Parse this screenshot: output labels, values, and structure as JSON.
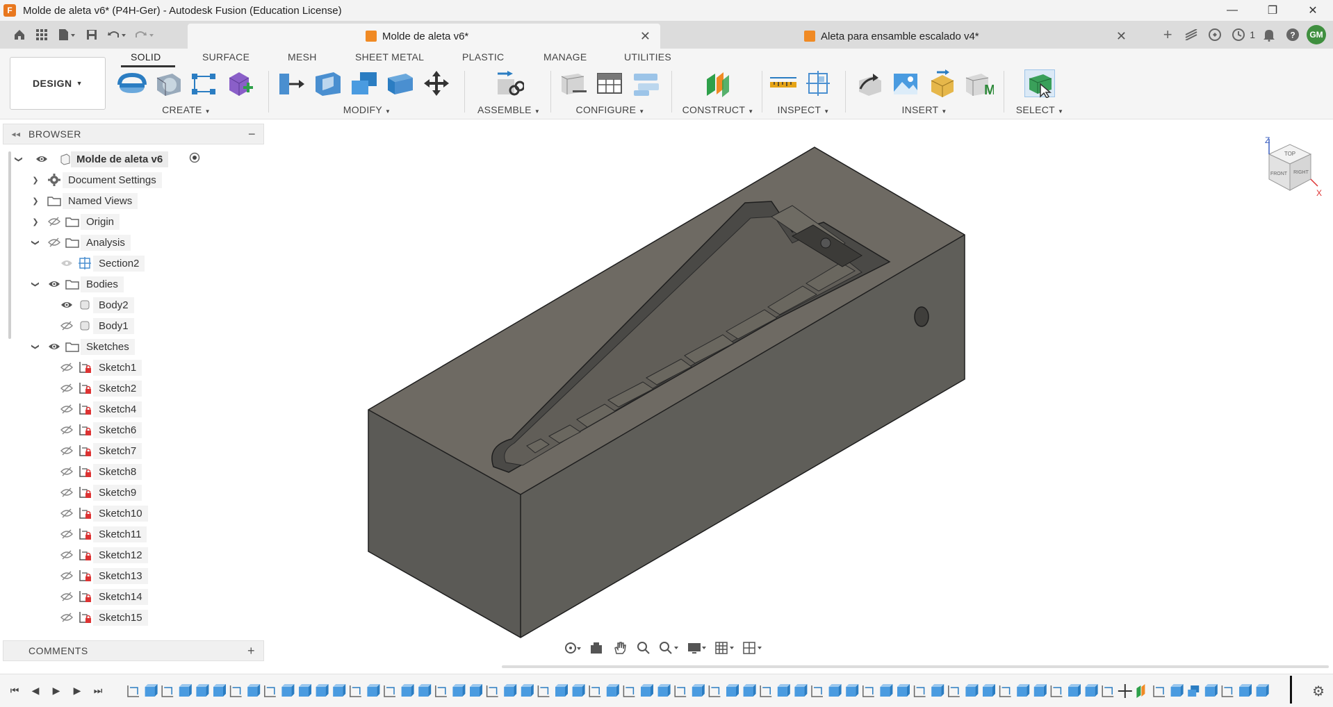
{
  "window": {
    "title": "Molde de aleta v6* (P4H-Ger) - Autodesk Fusion (Education License)",
    "minimize": "—",
    "maximize": "❐",
    "close": "✕"
  },
  "tabs": {
    "active": {
      "label": "Molde de aleta v6*",
      "close": "✕"
    },
    "inactive": {
      "label": "Aleta para ensamble escalado v4*",
      "close": "✕"
    },
    "plus": "+",
    "job_count": "1",
    "user_initials": "GM"
  },
  "toolbar": {
    "workspace": "DESIGN",
    "workspace_tabs": [
      "SOLID",
      "SURFACE",
      "MESH",
      "SHEET METAL",
      "PLASTIC",
      "MANAGE",
      "UTILITIES"
    ],
    "groups": {
      "create": "CREATE",
      "modify": "MODIFY",
      "assemble": "ASSEMBLE",
      "configure": "CONFIGURE",
      "construct": "CONSTRUCT",
      "inspect": "INSPECT",
      "insert": "INSERT",
      "select": "SELECT"
    }
  },
  "browser": {
    "title": "BROWSER",
    "items": [
      {
        "label": "Molde de aleta v6"
      },
      {
        "label": "Document Settings"
      },
      {
        "label": "Named Views"
      },
      {
        "label": "Origin"
      },
      {
        "label": "Analysis"
      },
      {
        "label": "Section2"
      },
      {
        "label": "Bodies"
      },
      {
        "label": "Body2"
      },
      {
        "label": "Body1"
      },
      {
        "label": "Sketches"
      },
      {
        "label": "Sketch1"
      },
      {
        "label": "Sketch2"
      },
      {
        "label": "Sketch4"
      },
      {
        "label": "Sketch6"
      },
      {
        "label": "Sketch7"
      },
      {
        "label": "Sketch8"
      },
      {
        "label": "Sketch9"
      },
      {
        "label": "Sketch10"
      },
      {
        "label": "Sketch11"
      },
      {
        "label": "Sketch12"
      },
      {
        "label": "Sketch13"
      },
      {
        "label": "Sketch14"
      },
      {
        "label": "Sketch15"
      }
    ]
  },
  "comments": {
    "title": "COMMENTS",
    "add": "+"
  },
  "viewcube": {
    "top": "TOP",
    "front": "FRONT",
    "right": "RIGHT",
    "z": "Z",
    "x": "X"
  },
  "colors": {
    "accent": "#0696d7",
    "model_top": "#6e6a63",
    "model_front": "#5c5b57",
    "model_side": "#4f4e4b"
  }
}
